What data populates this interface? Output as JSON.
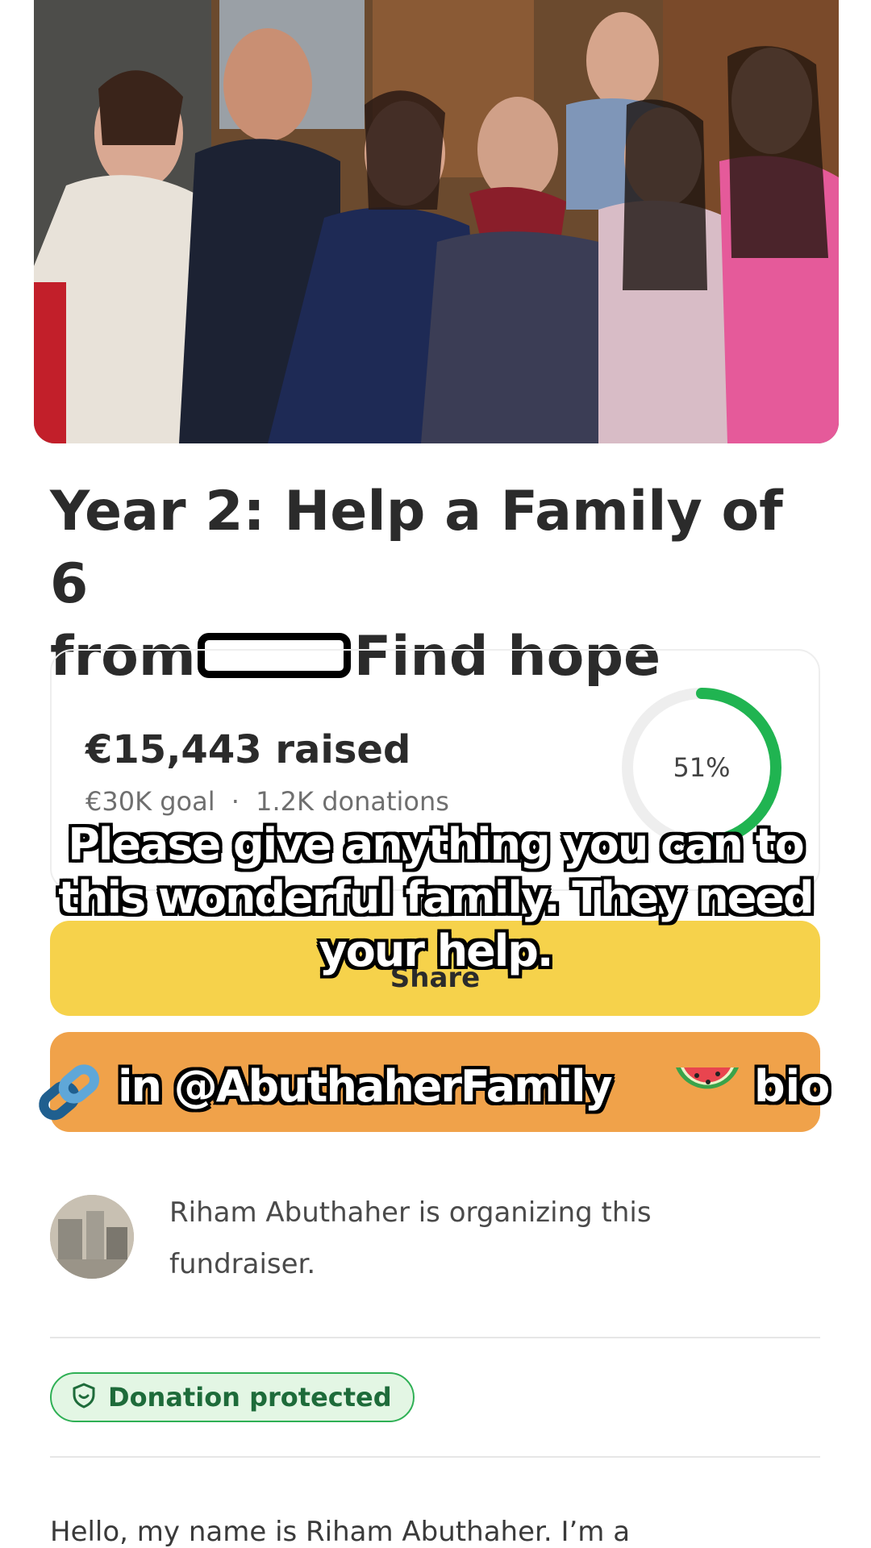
{
  "campaign": {
    "title_line1": "Year 2: Help a Family of 6",
    "title_from": "from",
    "title_after": "Find hope"
  },
  "progress": {
    "raised": "€15,443 raised",
    "goal": "€30K goal",
    "separator": "·",
    "donations": "1.2K donations",
    "percent_label": "51%",
    "percent_value": 0.51
  },
  "actions": {
    "share_label": "Share"
  },
  "overlay": {
    "lines": [
      "Please give anything you can to",
      "this wonderful family. They need",
      "your help."
    ],
    "link_text": "in @AbuthaherFamily",
    "link_tail": "bio"
  },
  "organizer": {
    "text": "Riham Abuthaher is organizing this fundraiser."
  },
  "badge": {
    "label": "Donation protected"
  },
  "story": {
    "intro": "Hello, my name is Riham Abuthaher. I’m a"
  },
  "colors": {
    "share": "#f6d24b",
    "donate": "#f0a24a",
    "progress_ring": "#20b451",
    "badge_border": "#2fb055"
  },
  "icons": [
    "link-icon",
    "watermelon-icon",
    "shield-icon"
  ]
}
